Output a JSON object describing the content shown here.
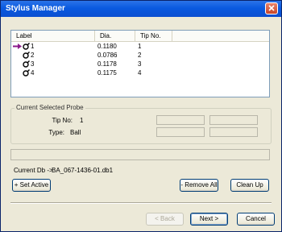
{
  "window": {
    "title": "Stylus Manager"
  },
  "list": {
    "columns": [
      "Label",
      "Dia.",
      "Tip No."
    ],
    "rows": [
      {
        "label": "1",
        "dia": "0.1180",
        "tip": "1",
        "selected": true
      },
      {
        "label": "2",
        "dia": "0.0786",
        "tip": "2",
        "selected": false
      },
      {
        "label": "3",
        "dia": "0.1178",
        "tip": "3",
        "selected": false
      },
      {
        "label": "4",
        "dia": "0.1175",
        "tip": "4",
        "selected": false
      }
    ]
  },
  "current_probe": {
    "title": "Current Selected Probe",
    "tip_label": "Tip No:",
    "tip_value": "1",
    "type_label": "Type:",
    "type_value": "Ball"
  },
  "current_db": {
    "label": "Current Db ->",
    "value": "BA_067-1436-01.db1"
  },
  "buttons": {
    "set_active": "+ Set Active",
    "remove_all": "- Remove All",
    "clean_up": "Clean Up",
    "back": "< Back",
    "next": "Next >",
    "cancel": "Cancel"
  },
  "icons": {
    "selected_marker": "arrow-right-icon",
    "probe": "stylus-probe-icon",
    "close": "close-icon"
  },
  "colors": {
    "titlebar": "#0a5ae0",
    "marker": "#8b1a8b",
    "window_bg": "#ece9d8"
  }
}
